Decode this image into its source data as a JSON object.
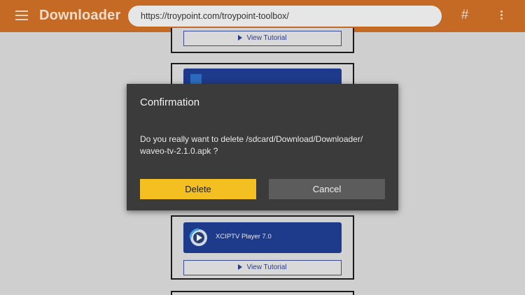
{
  "appbar": {
    "title": "Downloader",
    "url": "https://troypoint.com/troypoint-toolbox/",
    "hash_label": "#"
  },
  "content": {
    "tutorial_label": "View Tutorial",
    "app_tile_name": "XCIPTV Player 7.0"
  },
  "dialog": {
    "title": "Confirmation",
    "message_line1": "Do you really want to delete /sdcard/Download/Downloader/",
    "message_line2": "waveo-tv-2.1.0.apk ?",
    "delete_label": "Delete",
    "cancel_label": "Cancel"
  },
  "colors": {
    "appbar": "#c46a24",
    "delete_button": "#f4c021",
    "cancel_button": "#5c5c5c",
    "dialog_bg": "#3b3b3b",
    "tile_bg": "#1e3a8a"
  }
}
